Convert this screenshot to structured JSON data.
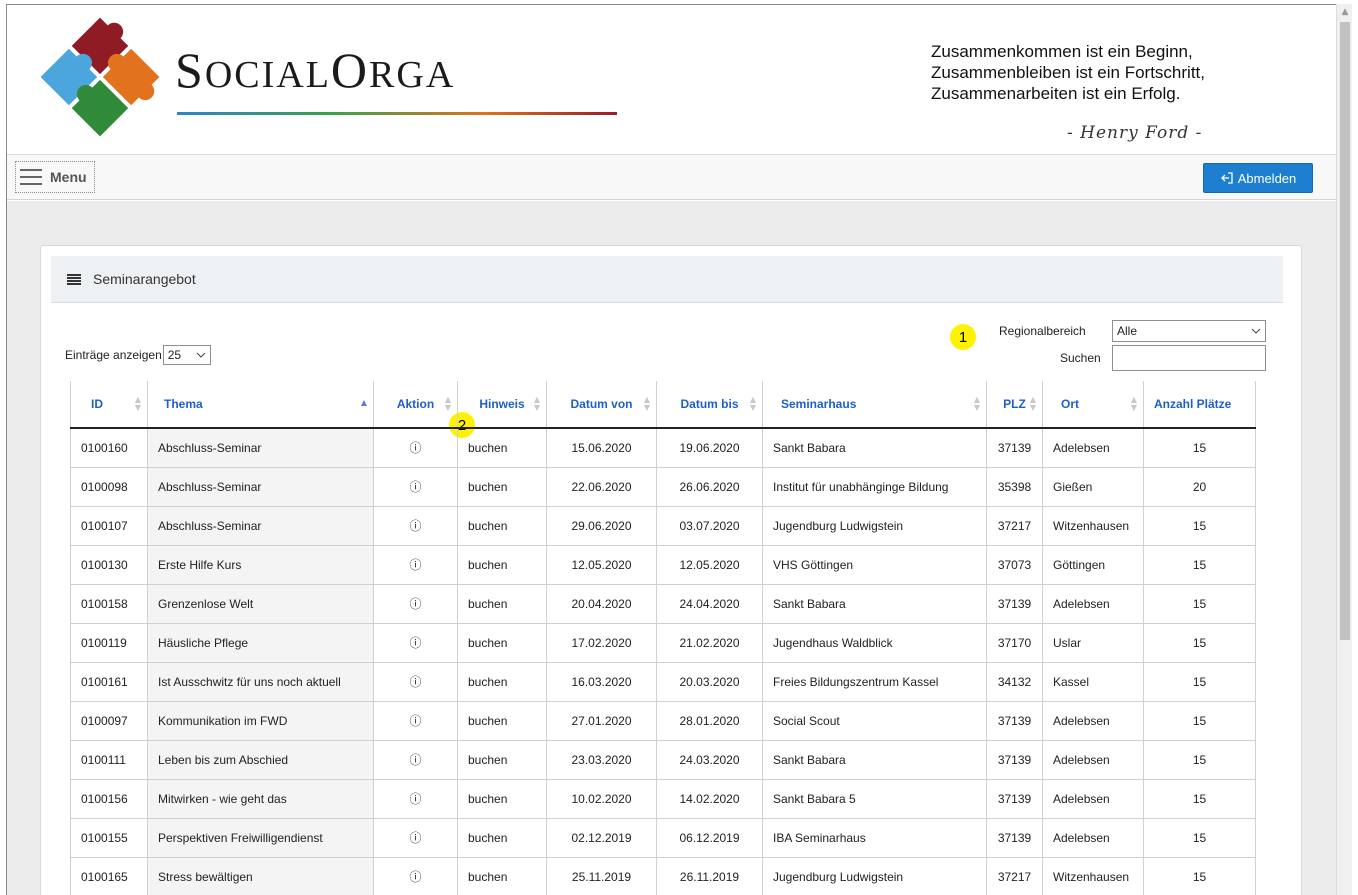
{
  "header": {
    "logo_text_big1": "S",
    "logo_text_small1": "OCIAL",
    "logo_text_big2": "O",
    "logo_text_small2": "RGA",
    "quote_lines": [
      "Zusammenkommen ist ein Beginn,",
      "Zusammenbleiben ist ein Fortschritt,",
      "Zusammenarbeiten ist ein Erfolg."
    ],
    "quote_author": "- Henry Ford -"
  },
  "toolbar": {
    "menu_label": "Menu",
    "logout_label": "Abmelden"
  },
  "card": {
    "title": "Seminarangebot",
    "entries_label": "Einträge anzeigen",
    "entries_value": "25",
    "region_label": "Regionalbereich",
    "region_value": "Alle",
    "search_label": "Suchen",
    "search_value": ""
  },
  "callouts": [
    "1",
    "2"
  ],
  "table": {
    "columns": [
      "ID",
      "Thema",
      "Aktion",
      "Hinweis",
      "Datum von",
      "Datum bis",
      "Seminarhaus",
      "PLZ",
      "Ort",
      "Anzahl Plätze"
    ],
    "rows": [
      [
        "0100160",
        "Abschluss-Seminar",
        "ⓘ",
        "buchen",
        "15.06.2020",
        "19.06.2020",
        "Sankt Babara",
        "37139",
        "Adelebsen",
        "15"
      ],
      [
        "0100098",
        "Abschluss-Seminar",
        "ⓘ",
        "buchen",
        "22.06.2020",
        "26.06.2020",
        "Institut für unabhänginge Bildung",
        "35398",
        "Gießen",
        "20"
      ],
      [
        "0100107",
        "Abschluss-Seminar",
        "ⓘ",
        "buchen",
        "29.06.2020",
        "03.07.2020",
        "Jugendburg Ludwigstein",
        "37217",
        "Witzenhausen",
        "15"
      ],
      [
        "0100130",
        "Erste Hilfe Kurs",
        "ⓘ",
        "buchen",
        "12.05.2020",
        "12.05.2020",
        "VHS Göttingen",
        "37073",
        "Göttingen",
        "15"
      ],
      [
        "0100158",
        "Grenzenlose Welt",
        "ⓘ",
        "buchen",
        "20.04.2020",
        "24.04.2020",
        "Sankt Babara",
        "37139",
        "Adelebsen",
        "15"
      ],
      [
        "0100119",
        "Häusliche Pflege",
        "ⓘ",
        "buchen",
        "17.02.2020",
        "21.02.2020",
        "Jugendhaus Waldblick",
        "37170",
        "Uslar",
        "15"
      ],
      [
        "0100161",
        "Ist Ausschwitz für uns noch aktuell",
        "ⓘ",
        "buchen",
        "16.03.2020",
        "20.03.2020",
        "Freies Bildungszentrum Kassel",
        "34132",
        "Kassel",
        "15"
      ],
      [
        "0100097",
        "Kommunikation im FWD",
        "ⓘ",
        "buchen",
        "27.01.2020",
        "28.01.2020",
        "Social Scout",
        "37139",
        "Adelebsen",
        "15"
      ],
      [
        "0100111",
        "Leben bis zum Abschied",
        "ⓘ",
        "buchen",
        "23.03.2020",
        "24.03.2020",
        "Sankt Babara",
        "37139",
        "Adelebsen",
        "15"
      ],
      [
        "0100156",
        "Mitwirken - wie geht das",
        "ⓘ",
        "buchen",
        "10.02.2020",
        "14.02.2020",
        "Sankt Babara 5",
        "37139",
        "Adelebsen",
        "15"
      ],
      [
        "0100155",
        "Perspektiven Freiwilligendienst",
        "ⓘ",
        "buchen",
        "02.12.2019",
        "06.12.2019",
        "IBA Seminarhaus",
        "37139",
        "Adelebsen",
        "15"
      ],
      [
        "0100165",
        "Stress bewältigen",
        "ⓘ",
        "buchen",
        "25.11.2019",
        "26.11.2019",
        "Jugendburg Ludwigstein",
        "37217",
        "Witzenhausen",
        "15"
      ]
    ]
  },
  "colors": {
    "accent": "#1e7fd0",
    "link": "#1f5fc8",
    "callout": "#fff200"
  }
}
